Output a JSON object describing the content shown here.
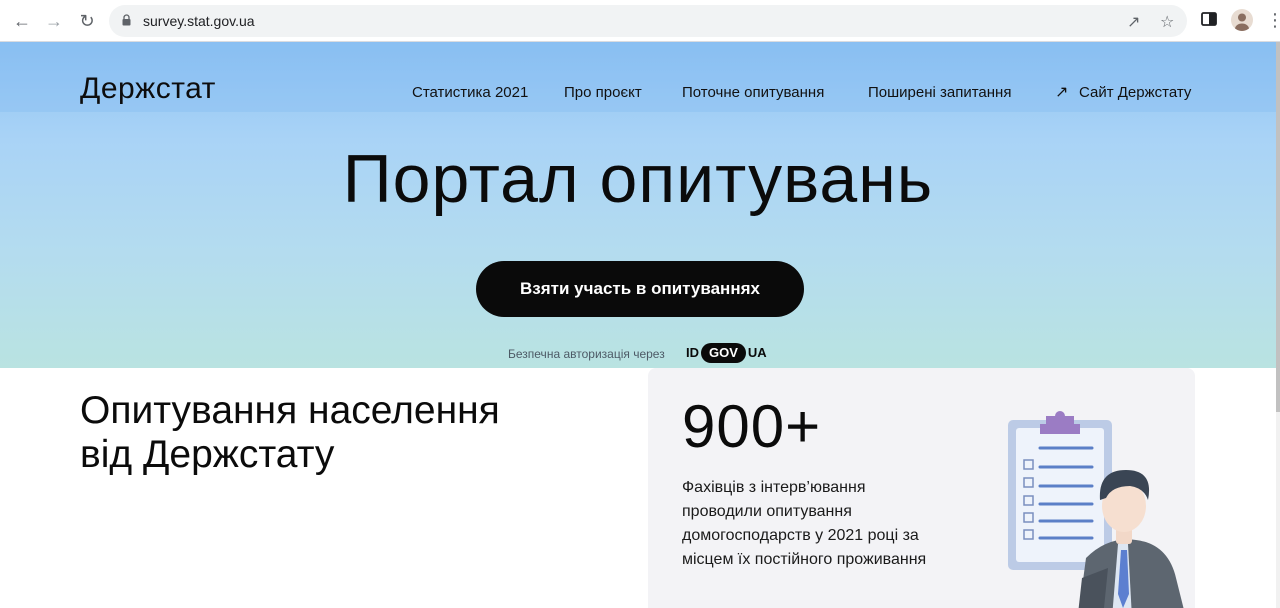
{
  "browser": {
    "url": "survey.stat.gov.ua"
  },
  "header": {
    "logo": "Держстат",
    "nav": [
      {
        "label": "Статистика 2021"
      },
      {
        "label": "Про проєкт"
      },
      {
        "label": "Поточне опитування"
      },
      {
        "label": "Поширені запитання"
      },
      {
        "label": "Сайт Держстату"
      }
    ]
  },
  "hero": {
    "title": "Портал опитувань",
    "cta_label": "Взяти участь в опитуваннях",
    "secure_text": "Безпечна авторизація через",
    "idgov": {
      "left": "ID",
      "middle": "GOV",
      "right": "UA"
    }
  },
  "section": {
    "title_line1": "Опитування населення",
    "title_line2": "від Держстату"
  },
  "stat": {
    "number": "900+",
    "description": "Фахівців з інтерв’ювання проводили опитування домогосподарств у 2021 році за місцем їх постійного проживання"
  },
  "colors": {
    "accent": "#0a0a0a",
    "hero_top": "#8fc3f3",
    "hero_bottom": "#b9e3e1",
    "card_bg": "#f3f3f6"
  }
}
